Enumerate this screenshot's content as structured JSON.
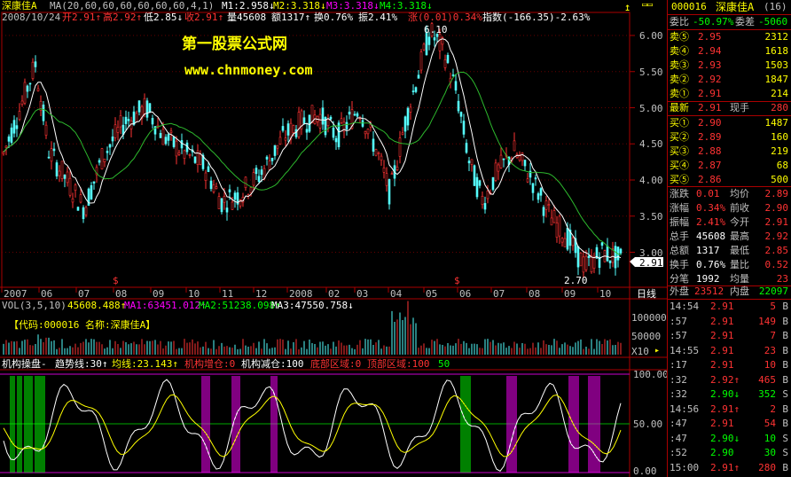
{
  "stock": {
    "name": "深康佳A",
    "code": "000016",
    "code_paren": "(16)"
  },
  "header": {
    "ma_label": "MA(20,60,60,60,60,60,60,4,1)",
    "m1": "M1:2.958↓",
    "m2": "M2:3.318↓",
    "m3": "M3:3.318↓",
    "m4": "M4:3.318↓",
    "date": "2008/10/24",
    "open": "开2.91↑",
    "high": "高2.92↑",
    "low": "低2.85↓",
    "close": "收2.91↑",
    "vol": "量45608",
    "amount": "额1317↑",
    "turnover": "换0.76%",
    "amplitude": "振2.41%",
    "change": "涨(0.01)0.34%",
    "index": "指数(-166.35)-2.63%"
  },
  "watermark": {
    "title": "第一股票公式网",
    "url": "www.chnmoney.com"
  },
  "price_axis": [
    "6.00",
    "5.50",
    "5.00",
    "4.50",
    "4.00",
    "3.50",
    "3.00"
  ],
  "price_marker": "2.91",
  "peak_label": "6.10",
  "low_label": "2.70",
  "x_axis": [
    "2007",
    "06",
    "07",
    "08",
    "09",
    "10",
    "11",
    "12",
    "2008",
    "02",
    "03",
    "04",
    "05",
    "06",
    "07",
    "08",
    "09",
    "10"
  ],
  "period": "日线",
  "volume": {
    "header_vol": "VOL(3,5,10)",
    "v": "45608.488↑",
    "ma1": "MA1:63451.012↑",
    "ma2": "MA2:51238.098↑",
    "ma3": "MA3:47550.758↓",
    "info": "【代码:000016 名称:深康佳A】",
    "axis_top": "100000",
    "axis_mid": "50000",
    "multiplier": "X10"
  },
  "indicator": {
    "name": "机构操盘-",
    "trend": "趋势线:30↑",
    "avg": "均线:23.143↑",
    "add": "机构增仓:0",
    "reduce": "机构减仓:100",
    "bottom": "底部区域:0",
    "top": "顶部区域:100",
    "fifty": "50",
    "axis": [
      "100.00",
      "50.00",
      "0.00"
    ]
  },
  "quote": {
    "wei_bi": "委比",
    "wei_bi_val": "-50.97%",
    "wei_cha": "委差",
    "wei_cha_val": "-5060",
    "asks": [
      {
        "label": "卖⑤",
        "price": "2.95",
        "vol": "2312"
      },
      {
        "label": "卖④",
        "price": "2.94",
        "vol": "1618"
      },
      {
        "label": "卖③",
        "price": "2.93",
        "vol": "1503"
      },
      {
        "label": "卖②",
        "price": "2.92",
        "vol": "1847"
      },
      {
        "label": "卖①",
        "price": "2.91",
        "vol": "214"
      }
    ],
    "last_label": "最新",
    "last": "2.91",
    "hand_label": "现手",
    "hand": "280",
    "bids": [
      {
        "label": "买①",
        "price": "2.90",
        "vol": "1487"
      },
      {
        "label": "买②",
        "price": "2.89",
        "vol": "160"
      },
      {
        "label": "买③",
        "price": "2.88",
        "vol": "219"
      },
      {
        "label": "买④",
        "price": "2.87",
        "vol": "68"
      },
      {
        "label": "买⑤",
        "price": "2.86",
        "vol": "500"
      }
    ],
    "stats": [
      {
        "l1": "涨跌",
        "v1": "0.01",
        "l2": "均价",
        "v2": "2.89"
      },
      {
        "l1": "涨幅",
        "v1": "0.34%",
        "l2": "前收",
        "v2": "2.90"
      },
      {
        "l1": "振幅",
        "v1": "2.41%",
        "l2": "今开",
        "v2": "2.91"
      },
      {
        "l1": "总手",
        "v1": "45608",
        "l2": "最高",
        "v2": "2.92"
      },
      {
        "l1": "总额",
        "v1": "1317",
        "l2": "最低",
        "v2": "2.85"
      },
      {
        "l1": "换手",
        "v1": "0.76%",
        "l2": "量比",
        "v2": "0.52"
      },
      {
        "l1": "分笔",
        "v1": "1992",
        "l2": "均量",
        "v2": "23"
      }
    ],
    "outer_label": "外盘",
    "outer": "23512",
    "inner_label": "内盘",
    "inner": "22097"
  },
  "ticks": [
    {
      "time": "14:54",
      "price": "2.91",
      "vol": "5",
      "side": "B"
    },
    {
      "time": ":57",
      "price": "2.91",
      "vol": "149",
      "side": "B"
    },
    {
      "time": ":57",
      "price": "2.91",
      "vol": "7",
      "side": "B"
    },
    {
      "time": "14:55",
      "price": "2.91",
      "vol": "23",
      "side": "B"
    },
    {
      "time": ":17",
      "price": "2.91",
      "vol": "10",
      "side": "B"
    },
    {
      "time": ":32",
      "price": "2.92↑",
      "vol": "465",
      "side": "B"
    },
    {
      "time": ":32",
      "price": "2.90↓",
      "vol": "352",
      "side": "S"
    },
    {
      "time": "14:56",
      "price": "2.91↑",
      "vol": "2",
      "side": "B"
    },
    {
      "time": ":47",
      "price": "2.91",
      "vol": "54",
      "side": "B"
    },
    {
      "time": ":47",
      "price": "2.90↓",
      "vol": "10",
      "side": "S"
    },
    {
      "time": ":52",
      "price": "2.90",
      "vol": "30",
      "side": "S"
    },
    {
      "time": "15:00",
      "price": "2.91↑",
      "vol": "280",
      "side": "B"
    }
  ]
}
